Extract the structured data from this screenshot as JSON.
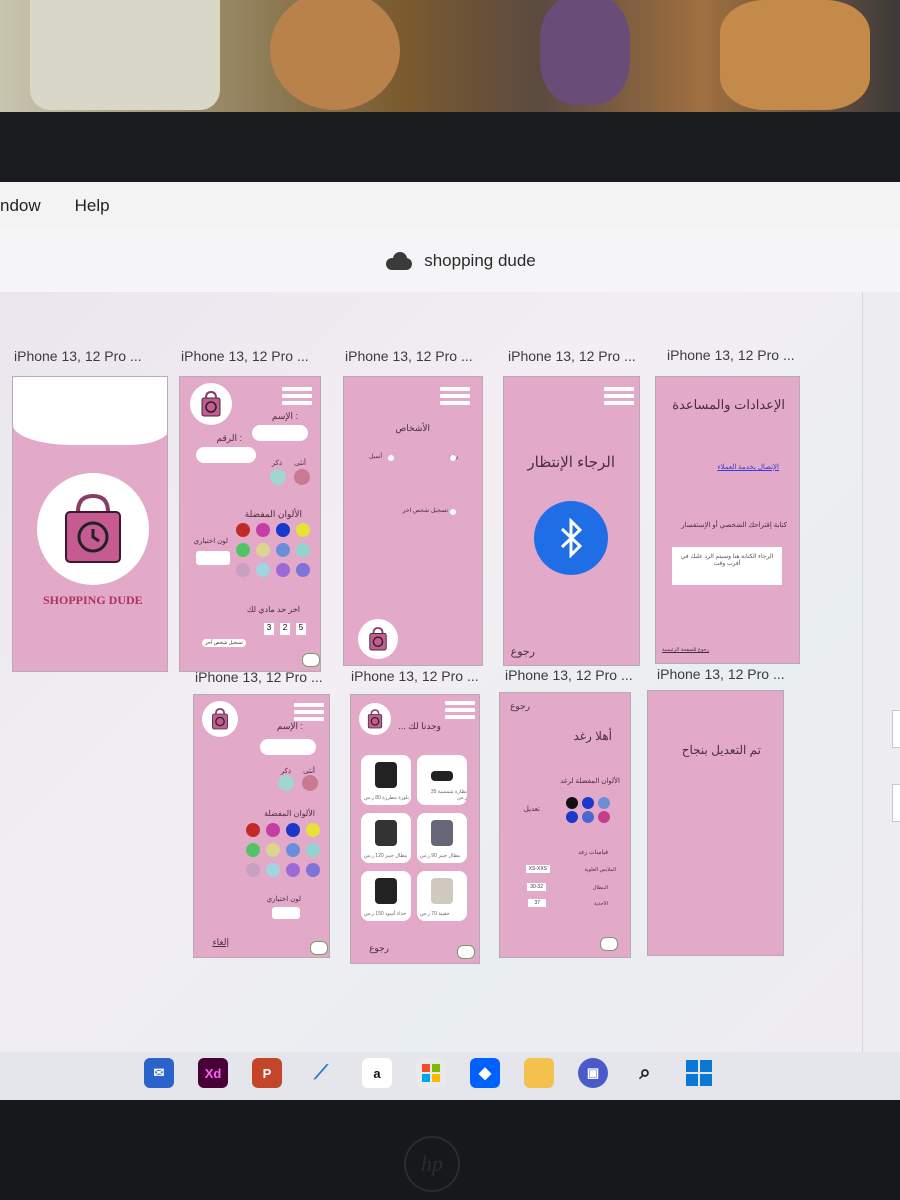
{
  "menu": [
    "ndow",
    "Help"
  ],
  "document_title": "shopping dude",
  "artboard_label": "iPhone 13, 12 Pro ...",
  "screens": {
    "splash": {
      "brand": "SHOPPING DUDE"
    },
    "profile": {
      "name_label": ": الإسم",
      "number_label": ": الرقم",
      "female": "أنثى",
      "male": "ذكر",
      "fav_colors": "الألوان المفضلة",
      "my_color": "لون اختياري",
      "choose_size": "اخر حد مادي لك",
      "digits": [
        "3",
        "2",
        "5"
      ],
      "footer_link": "تسجيل شخص آخر"
    },
    "persons": {
      "title": "الأشخاص",
      "opt1": "رغد",
      "opt2": "أسيل",
      "opt3": "تسجيل شخص اخر"
    },
    "waiting": {
      "title": "الرجاء الإنتظار",
      "back": "رجوع"
    },
    "settings": {
      "title": "الإعدادات والمساعدة",
      "contact": "الإتصال بخدمة العملاء",
      "suggestion_label": "كتابة إقتراحك الشخصي أو الإستفسار",
      "suggestion_box": "الرجاء الكتابة هنا وسيتم الرد عليك في أقرب وقت",
      "home_link": "رجوع للصفحة الرئيسية"
    },
    "profile_edit": {
      "name_label": ": الإسم",
      "female": "أنثى",
      "male": "ذكر",
      "fav_colors": "الألوان المفضلة",
      "my_color": "لون اختياري",
      "cancel": "إلغاء"
    },
    "found": {
      "title": "وجدنا لك ...",
      "back": "رجوع",
      "products": [
        "بلوزة مطرزة 80 ر.س",
        "نظارة شمسية 35 ر.س",
        "بنطال جينز 120 ر.س",
        "بنطال جينز 90 ر.س",
        "حذاء أسود 150 ر.س",
        "حقيبة 70 ر.س"
      ]
    },
    "hello": {
      "back": "رجوع",
      "title": "أهلا رغد",
      "fav_colors": "الألوان المفضلة لرغد",
      "edit": "تعديل",
      "sizes_title": "قياسات رغد",
      "top": "الملابس العلوية",
      "pants": "البنطال",
      "shoes": "الأحذية",
      "top_val": "XS-XXS",
      "pants_val": "30-32",
      "shoes_val": "37"
    },
    "done": {
      "title": "تم التعديل بنجاح"
    }
  },
  "colors": {
    "artboard_bg": "#e3a9c8",
    "palette": [
      "#c22a2a",
      "#c43ea5",
      "#1a38c9",
      "#e8e13a",
      "#52c468",
      "#dcd590",
      "#6a8fd8",
      "#94d4d0",
      "#c8a0c0",
      "#9fd6e0",
      "#9c6ad8",
      "#7c74d8"
    ]
  },
  "taskbar_icons": [
    "mail-icon",
    "xd-icon",
    "powerpoint-icon",
    "vscode-icon",
    "amazon-icon",
    "store-icon",
    "dropbox-icon",
    "folder-icon",
    "chat-icon",
    "search-icon",
    "windows-icon"
  ]
}
